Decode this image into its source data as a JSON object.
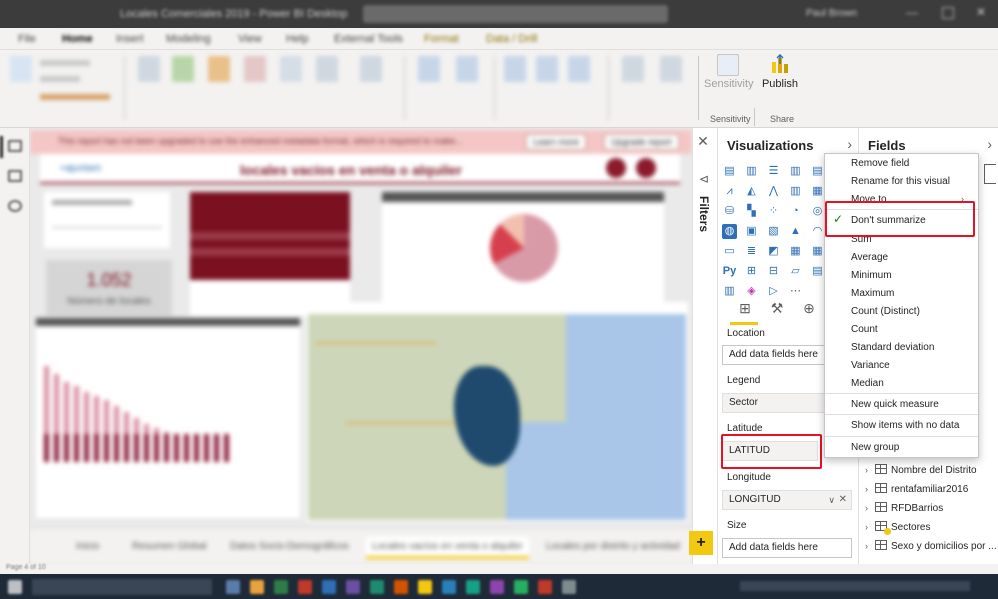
{
  "window": {
    "title": "Locales Comerciales 2019 - Power BI Desktop",
    "user": "Paul Brown"
  },
  "ribbon_tabs": [
    "File",
    "Home",
    "Insert",
    "Modeling",
    "View",
    "Help",
    "External Tools",
    "Format",
    "Data / Drill"
  ],
  "ribbon": {
    "sensitivity_label": "Sensitivity",
    "sensitivity_group": "Sensitivity",
    "publish_label": "Publish",
    "share_group": "Share"
  },
  "canvas": {
    "banner_text": "This report has not been upgraded to use the enhanced metadata format, which is required to make...",
    "banner_learn": "Learn more",
    "banner_upgrade": "Upgrade report",
    "report_title": "locales vacíos en venta o alquiler",
    "kpi_value": "1.052",
    "kpi_label": "Número de locales",
    "page_tabs": [
      "Inicio",
      "Resumen Global",
      "Datos Socio-Demográficos",
      "Locales vacíos en venta o alquiler",
      "Locales por distrito y actividad"
    ],
    "active_page_index": 3,
    "page_indicator": "Page 4 of 10"
  },
  "filters_pane": {
    "label": "Filters"
  },
  "visualizations": {
    "title": "Visualizations",
    "wells": [
      {
        "label": "Location",
        "value": "",
        "placeholder": "Add data fields here"
      },
      {
        "label": "Legend",
        "value": "Sector"
      },
      {
        "label": "Latitude",
        "value": "LATITUD"
      },
      {
        "label": "Longitude",
        "value": "LONGITUD"
      },
      {
        "label": "Size",
        "value": "",
        "placeholder": "Add data fields here"
      }
    ]
  },
  "fields": {
    "title": "Fields",
    "tables": [
      "Nombre del Distrito",
      "rentafamiliar2016",
      "RFDBarrios",
      "Sectores",
      "Sexo y domicilios por ..."
    ],
    "side_text": "s"
  },
  "context_menu": {
    "items": [
      {
        "label": "Remove field"
      },
      {
        "label": "Rename for this visual"
      },
      {
        "label": "Move to"
      },
      {
        "label": "Don't summarize",
        "checked": true
      },
      {
        "label": "Sum"
      },
      {
        "label": "Average"
      },
      {
        "label": "Minimum"
      },
      {
        "label": "Maximum"
      },
      {
        "label": "Count (Distinct)"
      },
      {
        "label": "Count"
      },
      {
        "label": "Standard deviation"
      },
      {
        "label": "Variance"
      },
      {
        "label": "Median"
      },
      {
        "label": "New quick measure"
      },
      {
        "label": "Show items with no data"
      },
      {
        "label": "New group"
      }
    ]
  },
  "colors": {
    "accent_yellow": "#f2c811",
    "highlight_red": "#e81123",
    "report_maroon": "#7a1020",
    "check_green": "#107c10"
  }
}
